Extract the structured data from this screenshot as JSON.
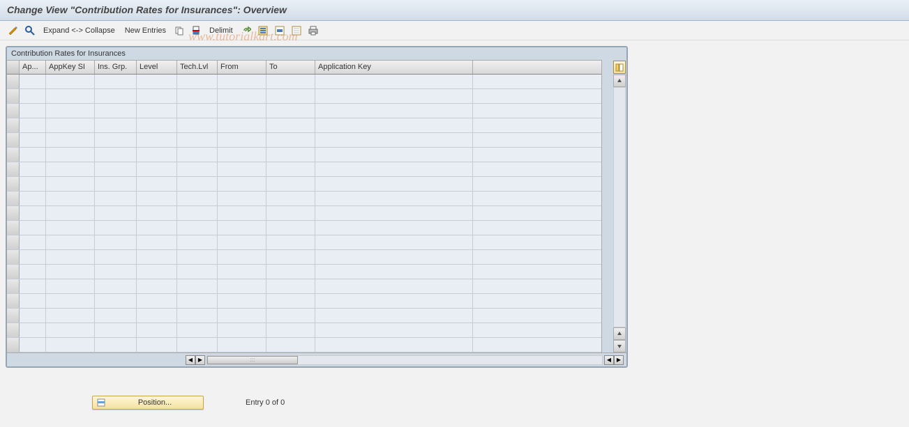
{
  "title": "Change View \"Contribution Rates for Insurances\": Overview",
  "toolbar": {
    "expand_collapse": "Expand <-> Collapse",
    "new_entries": "New Entries",
    "delimit": "Delimit"
  },
  "watermark": "www.tutorialkart.com",
  "panel": {
    "title": "Contribution Rates for Insurances",
    "columns": [
      "Ap...",
      "AppKey SI",
      "Ins. Grp.",
      "Level",
      "Tech.Lvl",
      "From",
      "To",
      "Application Key"
    ],
    "rows": []
  },
  "footer": {
    "position_label": "Position...",
    "entry_text": "Entry 0 of 0"
  }
}
